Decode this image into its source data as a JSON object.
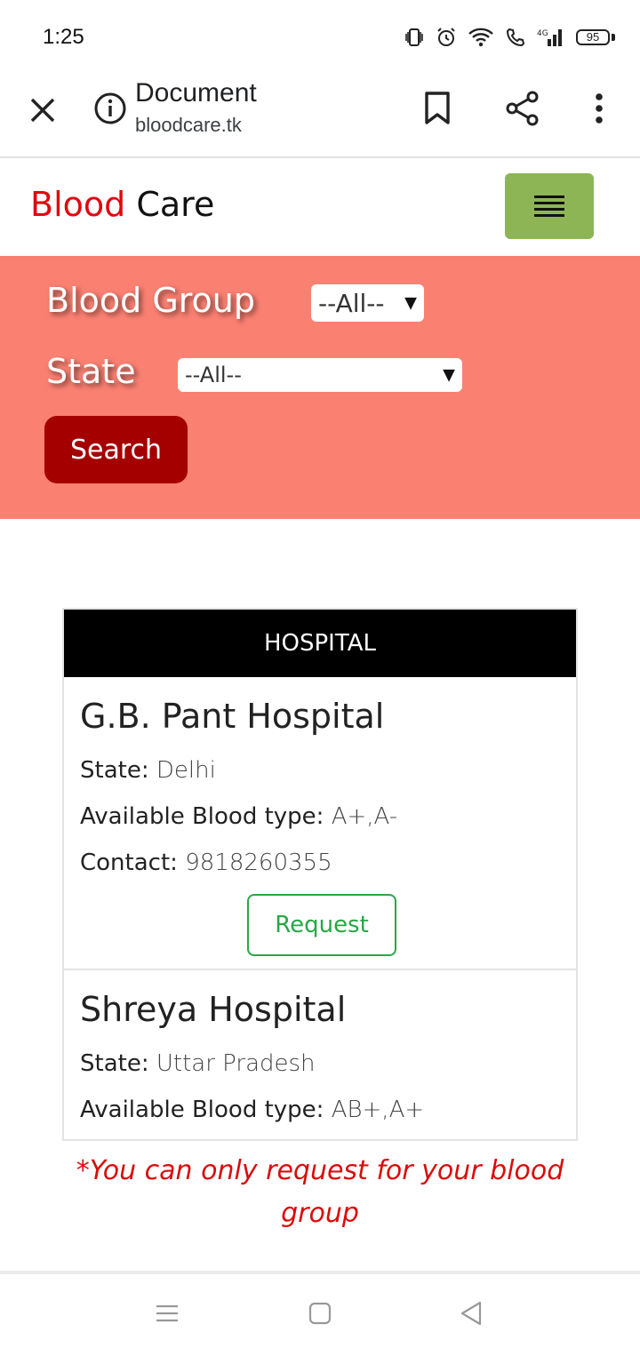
{
  "status_bar": {
    "time": "1:25",
    "battery": "95",
    "network": "4G"
  },
  "browser": {
    "page_title": "Document",
    "url": "bloodcare.tk"
  },
  "site": {
    "brand_part1": "Blood",
    "brand_part2": "Care",
    "brand_color": "#e0080f",
    "menu_color": "#8db556"
  },
  "search": {
    "blood_group_label": "Blood Group",
    "blood_group_value": "--All--",
    "state_label": "State",
    "state_value": "--All--",
    "search_button": "Search",
    "panel_color": "#fa8072",
    "button_color": "#a50000"
  },
  "table": {
    "header": "HOSPITAL",
    "hospitals": [
      {
        "name": "G.B. Pant Hospital",
        "state_key": "State:",
        "state": "Delhi",
        "blood_key": "Available Blood type:",
        "blood_types": "A+,A-",
        "contact_key": "Contact:",
        "contact": "9818260355",
        "request_label": "Request"
      },
      {
        "name": "Shreya Hospital",
        "state_key": "State:",
        "state": "Uttar Pradesh",
        "blood_key": "Available Blood type:",
        "blood_types": "AB+,A+"
      }
    ]
  },
  "note": "*You can only request for your blood group"
}
